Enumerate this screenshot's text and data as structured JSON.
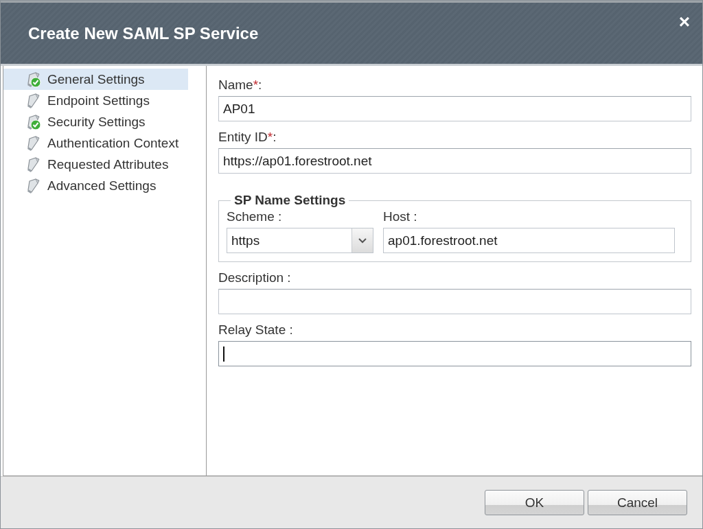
{
  "window": {
    "title": "Create New SAML SP Service",
    "close": "×"
  },
  "sidebar": {
    "items": [
      {
        "label": "General Settings",
        "kind": "done",
        "selected": true
      },
      {
        "label": "Endpoint Settings",
        "kind": "pending",
        "selected": false
      },
      {
        "label": "Security Settings",
        "kind": "done",
        "selected": false
      },
      {
        "label": "Authentication Context",
        "kind": "pending",
        "selected": false
      },
      {
        "label": "Requested Attributes",
        "kind": "pending",
        "selected": false
      },
      {
        "label": "Advanced Settings",
        "kind": "pending",
        "selected": false
      }
    ]
  },
  "form": {
    "name": {
      "label": "Name",
      "required_mark": "*",
      "colon": ":",
      "value": "AP01"
    },
    "entity_id": {
      "label": "Entity ID",
      "required_mark": "*",
      "colon": ":",
      "value": "https://ap01.forestroot.net"
    },
    "sp_name_settings": {
      "title": "SP Name Settings",
      "scheme": {
        "label": "Scheme :",
        "value": "https"
      },
      "host": {
        "label": "Host :",
        "value": "ap01.forestroot.net"
      }
    },
    "description": {
      "label": "Description :"
    },
    "relay_state": {
      "label": "Relay State :",
      "focused": true
    }
  },
  "buttons": [
    "OK",
    "Cancel"
  ]
}
